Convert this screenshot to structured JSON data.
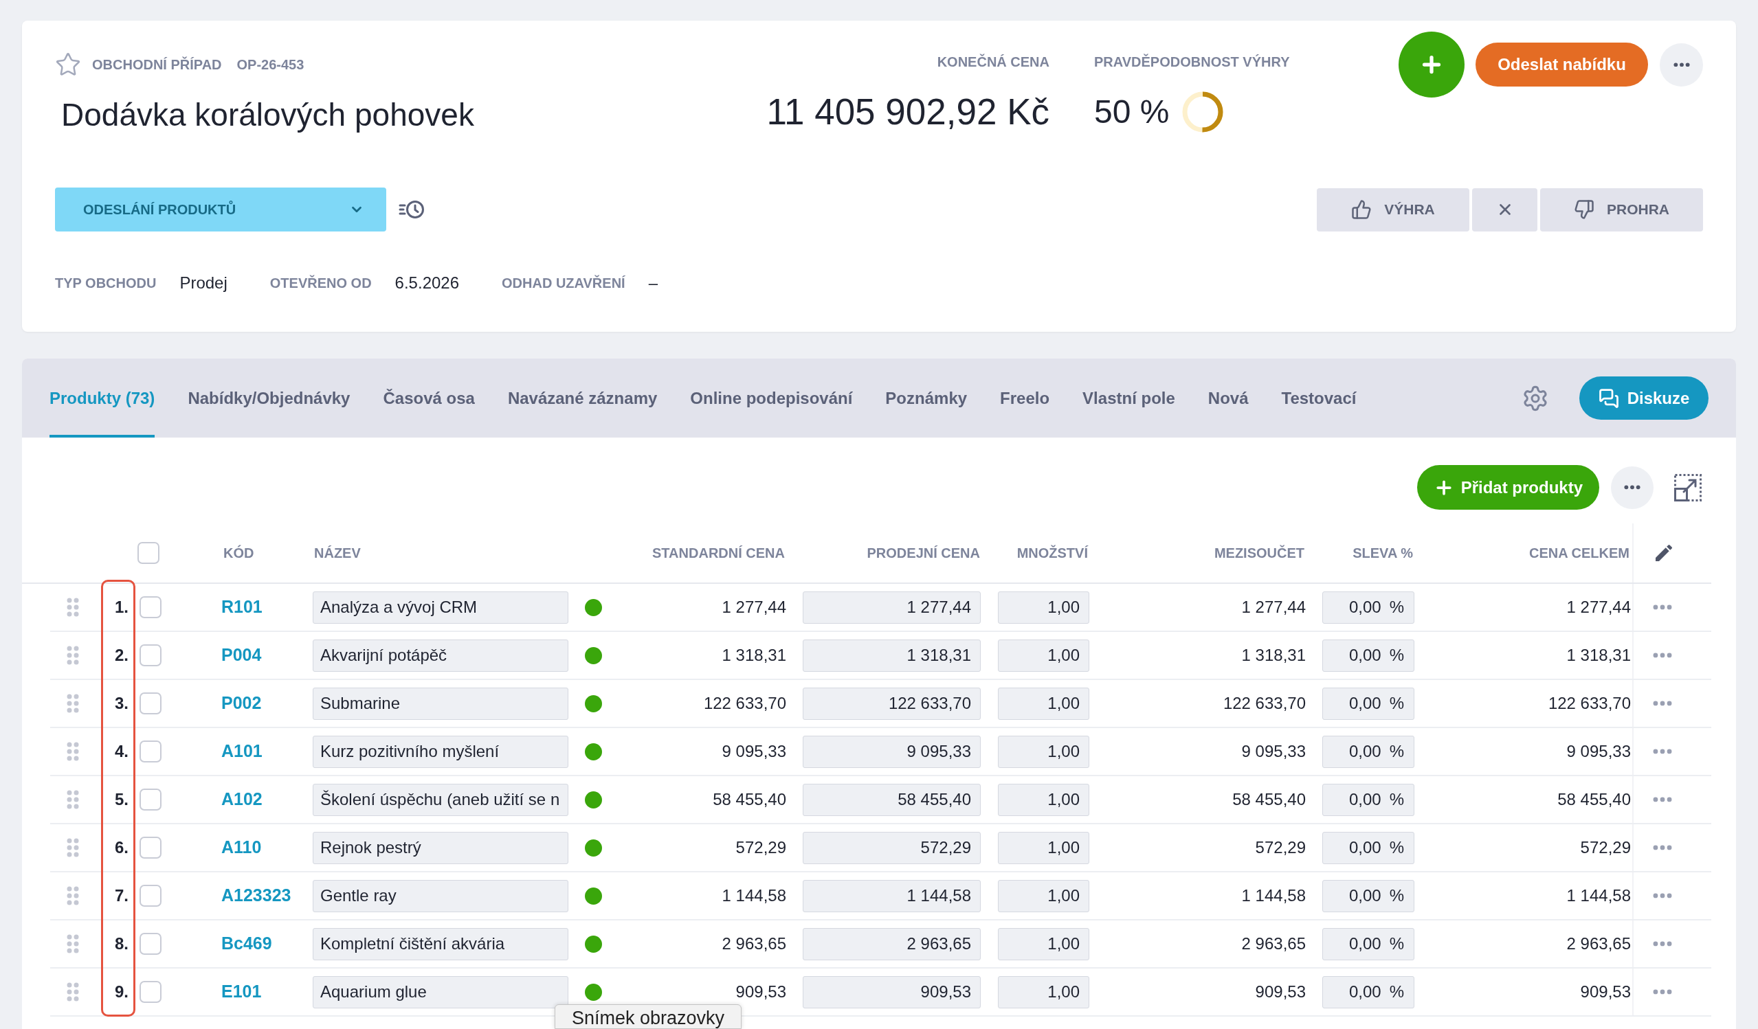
{
  "record": {
    "starred": false,
    "type_label": "OBCHODNÍ PŘÍPAD",
    "number": "OP-26-453",
    "title": "Dodávka korálových pohovek",
    "final_price": {
      "label": "KONEČNÁ CENA",
      "value": "11 405 902,92 Kč"
    },
    "win_probability": {
      "label": "PRAVDĚPODOBNOST VÝHRY",
      "value": "50 %",
      "level": 0.5
    },
    "send_offer_button": "Odeslat nabídku",
    "stage": {
      "label": "ODESLÁNÍ PRODUKTŮ"
    },
    "outcome_buttons": [
      {
        "kind": "win",
        "label": "VÝHRA"
      },
      {
        "kind": "reset"
      },
      {
        "kind": "loss",
        "label": "PROHRA"
      }
    ],
    "fields": [
      {
        "label": "TYP OBCHODU",
        "value": "Prodej"
      },
      {
        "label": "OTEVŘENO OD",
        "value": "6.5.2026"
      },
      {
        "label": "ODHAD UZAVŘENÍ",
        "value": "–"
      }
    ]
  },
  "tabs": [
    {
      "label": "Produkty (73)",
      "selected": true
    },
    {
      "label": "Nabídky/Objednávky",
      "selected": false
    },
    {
      "label": "Časová osa",
      "selected": false
    },
    {
      "label": "Navázané záznamy",
      "selected": false
    },
    {
      "label": "Online podepisování",
      "selected": false
    },
    {
      "label": "Poznámky",
      "selected": false
    },
    {
      "label": "Freelo",
      "selected": false
    },
    {
      "label": "Vlastní pole",
      "selected": false
    },
    {
      "label": "Nová",
      "selected": false
    },
    {
      "label": "Testovací",
      "selected": false
    }
  ],
  "discussion_button": "Diskuze",
  "products": {
    "add_button": "Přidat produkty",
    "select_all": {
      "checked": false
    },
    "columns": [
      "KÓD",
      "NÁZEV",
      "STANDARDNÍ CENA",
      "PRODEJNÍ CENA",
      "MNOŽSTVÍ",
      "MEZISOUČET",
      "SLEVA %",
      "CENA CELKEM"
    ],
    "rows": [
      {
        "number": "1.",
        "checked": false,
        "code": "R101",
        "name": "Analýza a vývoj CRM",
        "color": "#3aa60b",
        "standard_price": "1 277,44",
        "sale_price": "1 277,44",
        "quantity": "1,00",
        "subtotal": "1 277,44",
        "discount": "0,00",
        "discount_unit": "%",
        "total": "1 277,44"
      },
      {
        "number": "2.",
        "checked": false,
        "code": "P004",
        "name": "Akvarijní potápěč",
        "color": "#3aa60b",
        "standard_price": "1 318,31",
        "sale_price": "1 318,31",
        "quantity": "1,00",
        "subtotal": "1 318,31",
        "discount": "0,00",
        "discount_unit": "%",
        "total": "1 318,31"
      },
      {
        "number": "3.",
        "checked": false,
        "code": "P002",
        "name": "Submarine",
        "color": "#3aa60b",
        "standard_price": "122 633,70",
        "sale_price": "122 633,70",
        "quantity": "1,00",
        "subtotal": "122 633,70",
        "discount": "0,00",
        "discount_unit": "%",
        "total": "122 633,70"
      },
      {
        "number": "4.",
        "checked": false,
        "code": "A101",
        "name": "Kurz pozitivního myšlení",
        "color": "#3aa60b",
        "standard_price": "9 095,33",
        "sale_price": "9 095,33",
        "quantity": "1,00",
        "subtotal": "9 095,33",
        "discount": "0,00",
        "discount_unit": "%",
        "total": "9 095,33"
      },
      {
        "number": "5.",
        "checked": false,
        "code": "A102",
        "name": "Školení úspěchu (aneb užití se n",
        "color": "#3aa60b",
        "standard_price": "58 455,40",
        "sale_price": "58 455,40",
        "quantity": "1,00",
        "subtotal": "58 455,40",
        "discount": "0,00",
        "discount_unit": "%",
        "total": "58 455,40"
      },
      {
        "number": "6.",
        "checked": false,
        "code": "A110",
        "name": "Rejnok pestrý",
        "color": "#3aa60b",
        "standard_price": "572,29",
        "sale_price": "572,29",
        "quantity": "1,00",
        "subtotal": "572,29",
        "discount": "0,00",
        "discount_unit": "%",
        "total": "572,29"
      },
      {
        "number": "7.",
        "checked": false,
        "code": "A123323",
        "name": "Gentle ray",
        "color": "#3aa60b",
        "standard_price": "1 144,58",
        "sale_price": "1 144,58",
        "quantity": "1,00",
        "subtotal": "1 144,58",
        "discount": "0,00",
        "discount_unit": "%",
        "total": "1 144,58"
      },
      {
        "number": "8.",
        "checked": false,
        "code": "Bc469",
        "name": "Kompletní čištění akvária",
        "color": "#3aa60b",
        "standard_price": "2 963,65",
        "sale_price": "2 963,65",
        "quantity": "1,00",
        "subtotal": "2 963,65",
        "discount": "0,00",
        "discount_unit": "%",
        "total": "2 963,65"
      },
      {
        "number": "9.",
        "checked": false,
        "code": "E101",
        "name": "Aquarium glue",
        "color": "#3aa60b",
        "standard_price": "909,53",
        "sale_price": "909,53",
        "quantity": "1,00",
        "subtotal": "909,53",
        "discount": "0,00",
        "discount_unit": "%",
        "total": "909,53"
      }
    ]
  },
  "tooltip": {
    "text": "Snímek obrazovky"
  }
}
